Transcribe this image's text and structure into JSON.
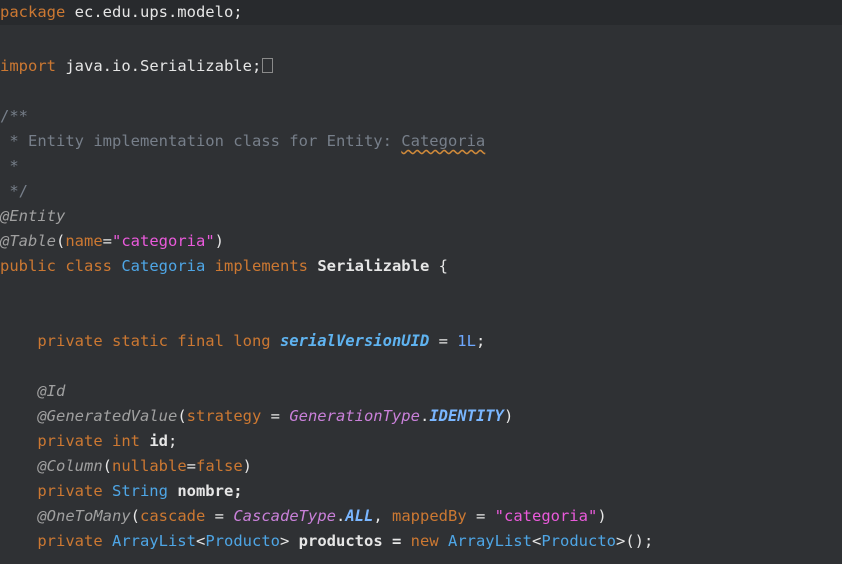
{
  "code": {
    "package_kw": "package",
    "package_name": " ec.edu.ups.modelo;",
    "import_kw": "import",
    "import_name": " java.io.Serializable;",
    "comment_open": "/**",
    "comment_line": " * Entity implementation class for Entity: ",
    "comment_class": "Categoria",
    "comment_star": " *",
    "comment_close": " */",
    "ann_entity": "@Entity",
    "ann_table": "@Table",
    "table_paren_open": "(",
    "table_attr": "name",
    "table_eq": "=",
    "table_value": "\"categoria\"",
    "table_paren_close": ")",
    "class_mods": "public class ",
    "class_name": "Categoria",
    "class_implements": " implements ",
    "class_iface": "Serializable",
    "class_brace": " {",
    "indent": "    ",
    "serial_mods": "private static final long ",
    "serial_name": "serialVersionUID",
    "serial_eq": " = ",
    "serial_value": "1L",
    "serial_end": ";",
    "ann_id": "@Id",
    "ann_generated": "@GeneratedValue",
    "gen_paren_open": "(",
    "gen_attr": "strategy",
    "gen_eq": " = ",
    "gen_type": "GenerationType",
    "gen_dot": ".",
    "gen_const": "IDENTITY",
    "gen_paren_close": ")",
    "id_mods": "private int ",
    "id_name": "id",
    "id_end": ";",
    "ann_column": "@Column",
    "col_paren_open": "(",
    "col_attr": "nullable",
    "col_eq": "=",
    "col_value": "false",
    "col_paren_close": ")",
    "nombre_mods": "private ",
    "nombre_type": "String",
    "nombre_name": " nombre;",
    "ann_onetomany": "@OneToMany",
    "otm_paren_open": "(",
    "otm_attr1": "cascade",
    "otm_eq1": " = ",
    "otm_type": "CascadeType",
    "otm_dot": ".",
    "otm_const": "ALL",
    "otm_comma": ", ",
    "otm_attr2": "mappedBy",
    "otm_eq2": " = ",
    "otm_value": "\"categoria\"",
    "otm_paren_close": ")",
    "prod_mods": "private ",
    "prod_type1": "ArrayList",
    "prod_lt1": "<",
    "prod_generic1": "Producto",
    "prod_gt1": ">",
    "prod_name": " productos = ",
    "prod_new": "new ",
    "prod_type2": "ArrayList",
    "prod_lt2": "<",
    "prod_generic2": "Producto",
    "prod_end": ">();"
  },
  "colors": {
    "background": "#2f3134",
    "keyword": "#cc7832",
    "string": "#ea5adb",
    "comment": "#777f8a",
    "type": "#4ea6e6"
  },
  "icons": {
    "fold_marker": "collapsed-fold-icon"
  }
}
